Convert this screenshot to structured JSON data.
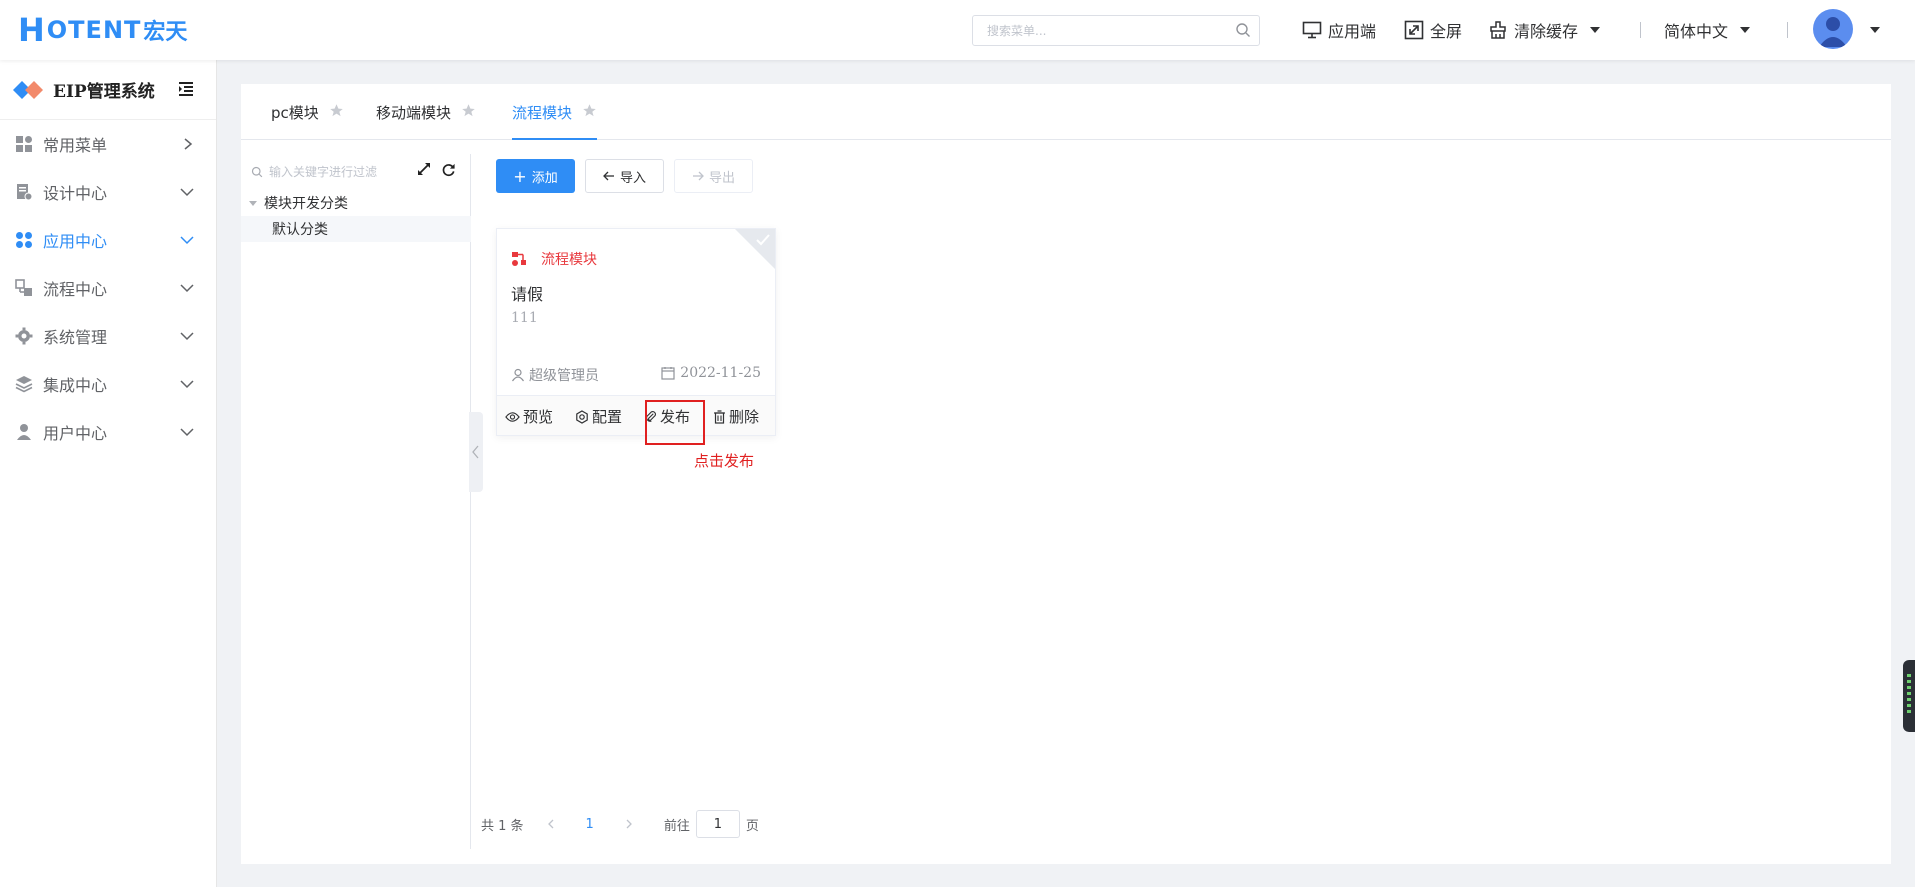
{
  "header": {
    "logo_mark": "H",
    "logo_word": "OTENT",
    "logo_cn": "宏天",
    "search_placeholder": "搜索菜单...",
    "app_end": "应用端",
    "fullscreen": "全屏",
    "clear_cache": "清除缓存",
    "language": "简体中文"
  },
  "sidebar": {
    "title": "EIP管理系统",
    "items": [
      {
        "label": "常用菜单",
        "icon": "grid-icon",
        "arrow": "right"
      },
      {
        "label": "设计中心",
        "icon": "design-doc-icon",
        "arrow": "down"
      },
      {
        "label": "应用中心",
        "icon": "apps-icon",
        "arrow": "down",
        "active": true
      },
      {
        "label": "流程中心",
        "icon": "flow-icon",
        "arrow": "down"
      },
      {
        "label": "系统管理",
        "icon": "gear-icon",
        "arrow": "down"
      },
      {
        "label": "集成中心",
        "icon": "layers-icon",
        "arrow": "down"
      },
      {
        "label": "用户中心",
        "icon": "user-icon",
        "arrow": "down"
      }
    ]
  },
  "tabs": [
    {
      "label": "pc模块"
    },
    {
      "label": "移动端模块"
    },
    {
      "label": "流程模块",
      "active": true
    }
  ],
  "tree": {
    "search_placeholder": "输入关键字进行过滤",
    "root": "模块开发分类",
    "child": "默认分类"
  },
  "toolbar": {
    "add": "添加",
    "import": "导入",
    "export": "导出"
  },
  "card": {
    "type": "流程模块",
    "name": "请假",
    "desc": "111",
    "creator": "超级管理员",
    "date": "2022-11-25",
    "actions": {
      "preview": "预览",
      "config": "配置",
      "publish": "发布",
      "delete": "删除"
    }
  },
  "annotation": "点击发布",
  "pager": {
    "total": "共 1 条",
    "current": "1",
    "goto": "前往",
    "page_value": "1",
    "page_suffix": "页"
  },
  "colors": {
    "accent": "#2f8df5",
    "danger": "#e02020",
    "module_red": "#e8383d"
  }
}
